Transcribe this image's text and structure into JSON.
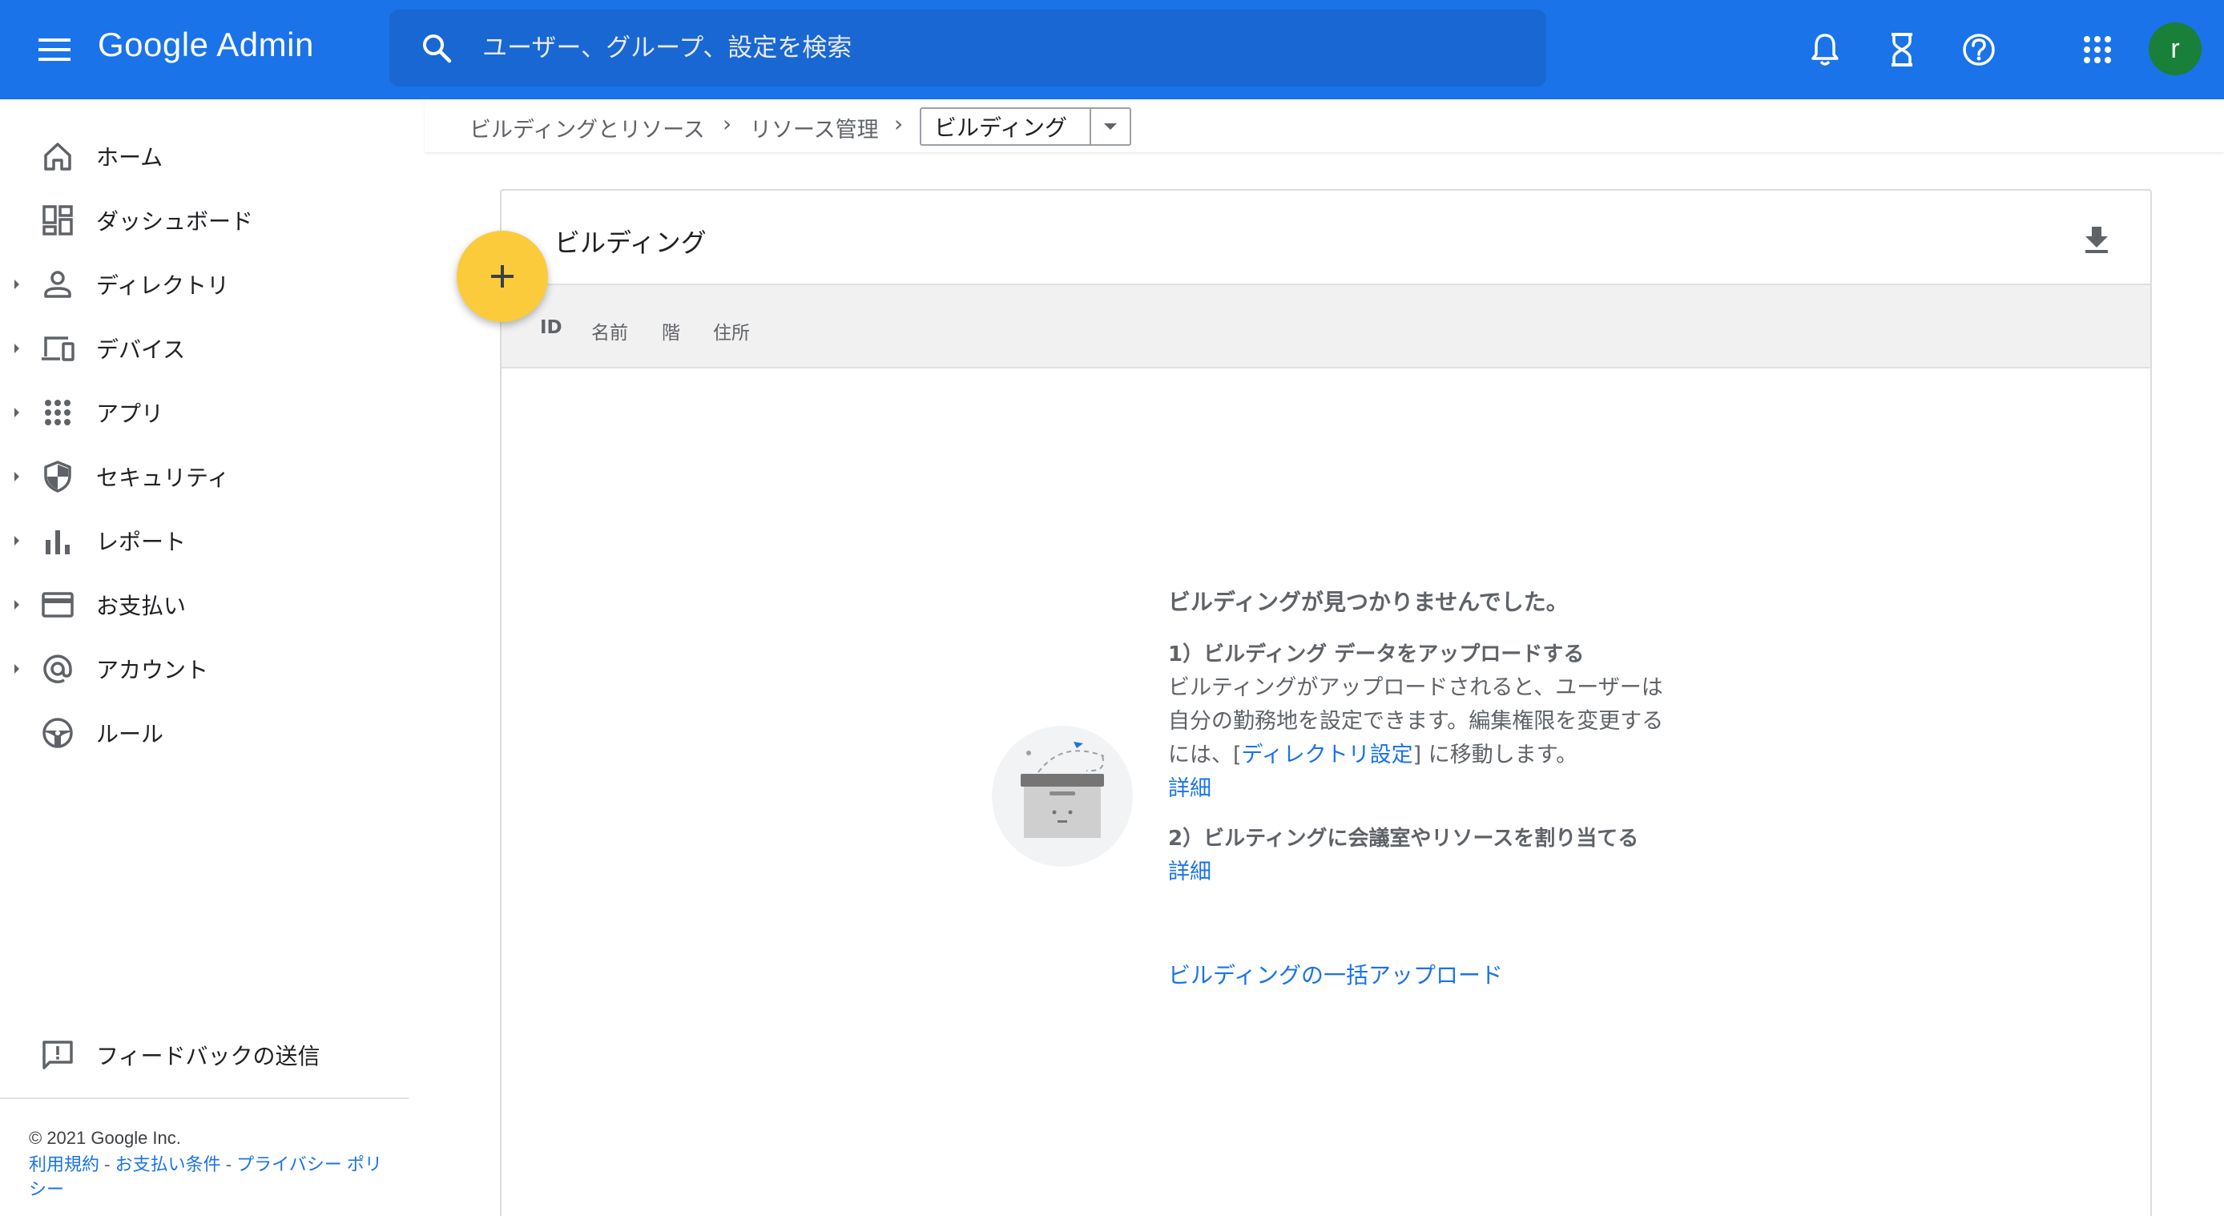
{
  "topbar": {
    "app_title": "Google Admin",
    "search_placeholder": "ユーザー、グループ、設定を検索",
    "avatar_initial": "r",
    "accent_color": "#1a73e8",
    "icons": [
      "menu-icon",
      "search-icon",
      "notifications-icon",
      "tasks-hourglass-icon",
      "help-icon",
      "apps-grid-icon"
    ]
  },
  "sidebar": {
    "items": [
      {
        "label": "ホーム",
        "icon": "home-icon",
        "expandable": false
      },
      {
        "label": "ダッシュボード",
        "icon": "dashboard-icon",
        "expandable": false
      },
      {
        "label": "ディレクトリ",
        "icon": "person-icon",
        "expandable": true
      },
      {
        "label": "デバイス",
        "icon": "devices-icon",
        "expandable": true
      },
      {
        "label": "アプリ",
        "icon": "apps-icon",
        "expandable": true
      },
      {
        "label": "セキュリティ",
        "icon": "shield-icon",
        "expandable": true
      },
      {
        "label": "レポート",
        "icon": "bar-chart-icon",
        "expandable": true
      },
      {
        "label": "お支払い",
        "icon": "credit-card-icon",
        "expandable": true
      },
      {
        "label": "アカウント",
        "icon": "at-sign-icon",
        "expandable": true
      },
      {
        "label": "ルール",
        "icon": "rules-icon",
        "expandable": false
      }
    ],
    "feedback_label": "フィードバックの送信",
    "copyright": "© 2021 Google Inc.",
    "footer_links": {
      "terms": "利用規約",
      "billing_terms": "お支払い条件",
      "privacy": "プライバシー ポリシー",
      "separator": " - "
    }
  },
  "breadcrumb": {
    "items": [
      "ビルディングとリソース",
      "リソース管理"
    ],
    "current": "ビルディング"
  },
  "card": {
    "title": "ビルディング",
    "columns": [
      "ID",
      "名前",
      "階",
      "住所"
    ],
    "empty": {
      "heading": "ビルディングが見つかりませんでした。",
      "step1_title": "1）ビルディング データをアップロードする",
      "step1_desc_before": "ビルティングがアップロードされると、ユーザーは自分の勤務地を設定できます。編集権限を変更するには、[",
      "step1_link": "ディレクトリ設定",
      "step1_desc_after": "] に移動します。",
      "step1_more": "詳細",
      "step2_title": "2）ビルティングに会議室やリソースを割り当てる",
      "step2_more": "詳細",
      "bulk_upload": "ビルディングの一括アップロード"
    }
  },
  "colors": {
    "fab": "#fbcb3c",
    "link": "#1a73e8",
    "avatar": "#188038"
  }
}
